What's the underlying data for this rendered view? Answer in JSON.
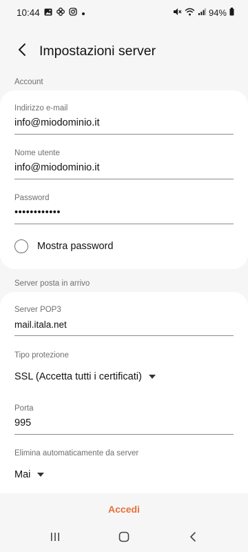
{
  "status_bar": {
    "time": "10:44",
    "battery": "94%",
    "left_icons": [
      "image-icon",
      "pinwheel-icon",
      "instagram-icon",
      "dot-icon"
    ],
    "right_icons": [
      "mute-icon",
      "wifi-icon",
      "signal-icon"
    ]
  },
  "header": {
    "title": "Impostazioni server",
    "back_icon": "back-arrow-icon"
  },
  "account_section": {
    "label": "Account",
    "email_label": "Indirizzo e-mail",
    "email_value": "info@miodominio.it",
    "username_label": "Nome utente",
    "username_value": "info@miodominio.it",
    "password_label": "Password",
    "password_value": "••••••••••••",
    "show_password_label": "Mostra password",
    "show_password_checked": false
  },
  "incoming_section": {
    "label": "Server posta in arrivo",
    "server_label": "Server POP3",
    "server_value": "mail.itala.net",
    "security_label": "Tipo protezione",
    "security_value": "SSL (Accetta tutti i certificati)",
    "port_label": "Porta",
    "port_value": "995",
    "delete_label": "Elimina automaticamente da server",
    "delete_value": "Mai"
  },
  "footer": {
    "login_label": "Accedi"
  },
  "nav_bar": {
    "icons": [
      "recents-icon",
      "home-icon",
      "back-icon"
    ]
  },
  "colors": {
    "accent": "#e8703a",
    "background": "#f6f6f6",
    "card": "#ffffff",
    "label_gray": "#6e6e6e"
  }
}
